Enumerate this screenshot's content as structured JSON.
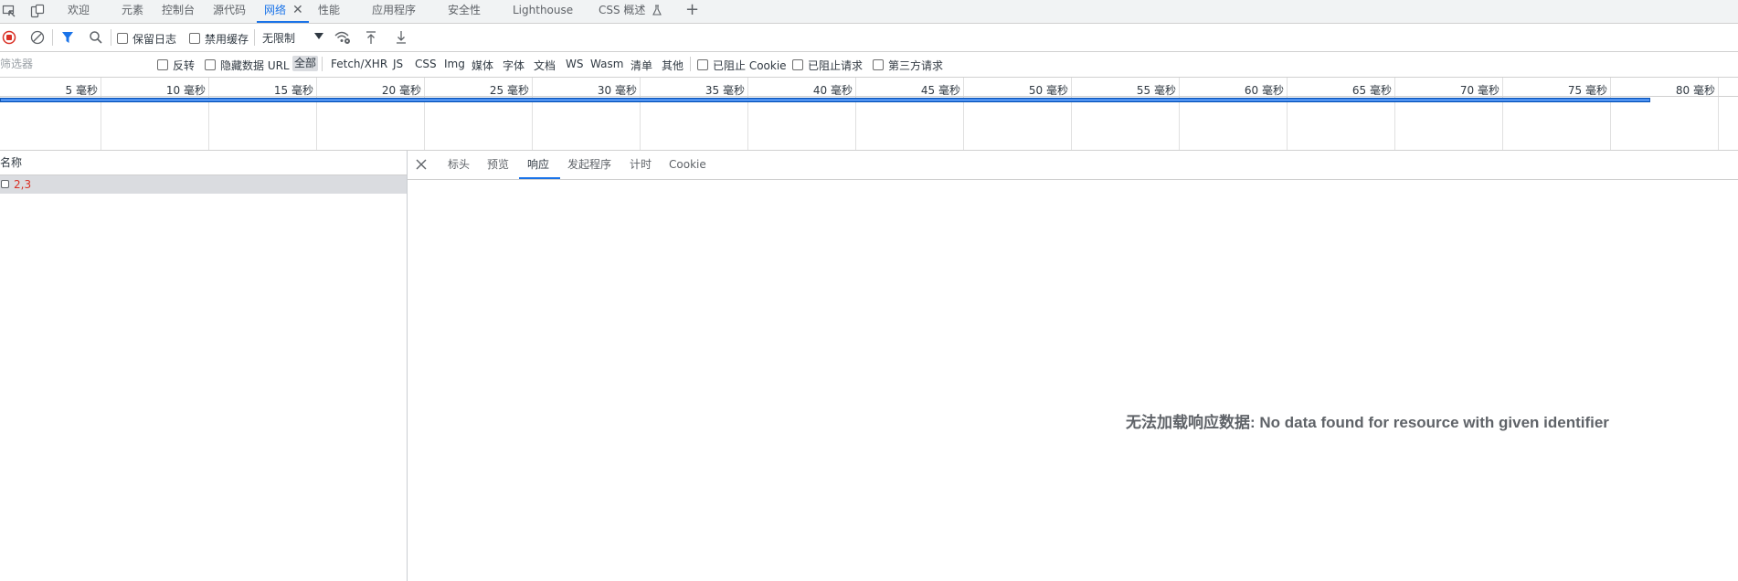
{
  "tabs": [
    {
      "label": "欢迎"
    },
    {
      "label": "元素"
    },
    {
      "label": "控制台"
    },
    {
      "label": "源代码"
    },
    {
      "label": "网络",
      "active": true
    },
    {
      "label": "性能"
    },
    {
      "label": "应用程序"
    },
    {
      "label": "安全性"
    },
    {
      "label": "Lighthouse"
    },
    {
      "label": "CSS 概述"
    }
  ],
  "toolbar": {
    "preserve_log": "保留日志",
    "disable_cache": "禁用缓存",
    "throttling": "无限制"
  },
  "filterbar": {
    "placeholder": "筛选器",
    "invert": "反转",
    "hide_data_urls": "隐藏数据 URL",
    "types": [
      "全部",
      "Fetch/XHR",
      "JS",
      "CSS",
      "Img",
      "媒体",
      "字体",
      "文档",
      "WS",
      "Wasm",
      "清单",
      "其他"
    ],
    "blocked_cookies": "已阻止 Cookie",
    "blocked_requests": "已阻止请求",
    "third_party": "第三方请求"
  },
  "timeline": {
    "ticks": [
      "5 毫秒",
      "10 毫秒",
      "15 毫秒",
      "20 毫秒",
      "25 毫秒",
      "30 毫秒",
      "35 毫秒",
      "40 毫秒",
      "45 毫秒",
      "50 毫秒",
      "55 毫秒",
      "60 毫秒",
      "65 毫秒",
      "70 毫秒",
      "75 毫秒",
      "80 毫秒"
    ]
  },
  "requests": {
    "column_name": "名称",
    "rows": [
      {
        "name": "2,3",
        "status": "error"
      }
    ]
  },
  "detail": {
    "tabs": [
      "标头",
      "预览",
      "响应",
      "发起程序",
      "计时",
      "Cookie"
    ],
    "active_tab": "响应",
    "message": "无法加载响应数据: No data found for resource with given identifier"
  },
  "colors": {
    "accent": "#1a73e8",
    "error_text": "#d93025",
    "record_red": "#d93025"
  }
}
